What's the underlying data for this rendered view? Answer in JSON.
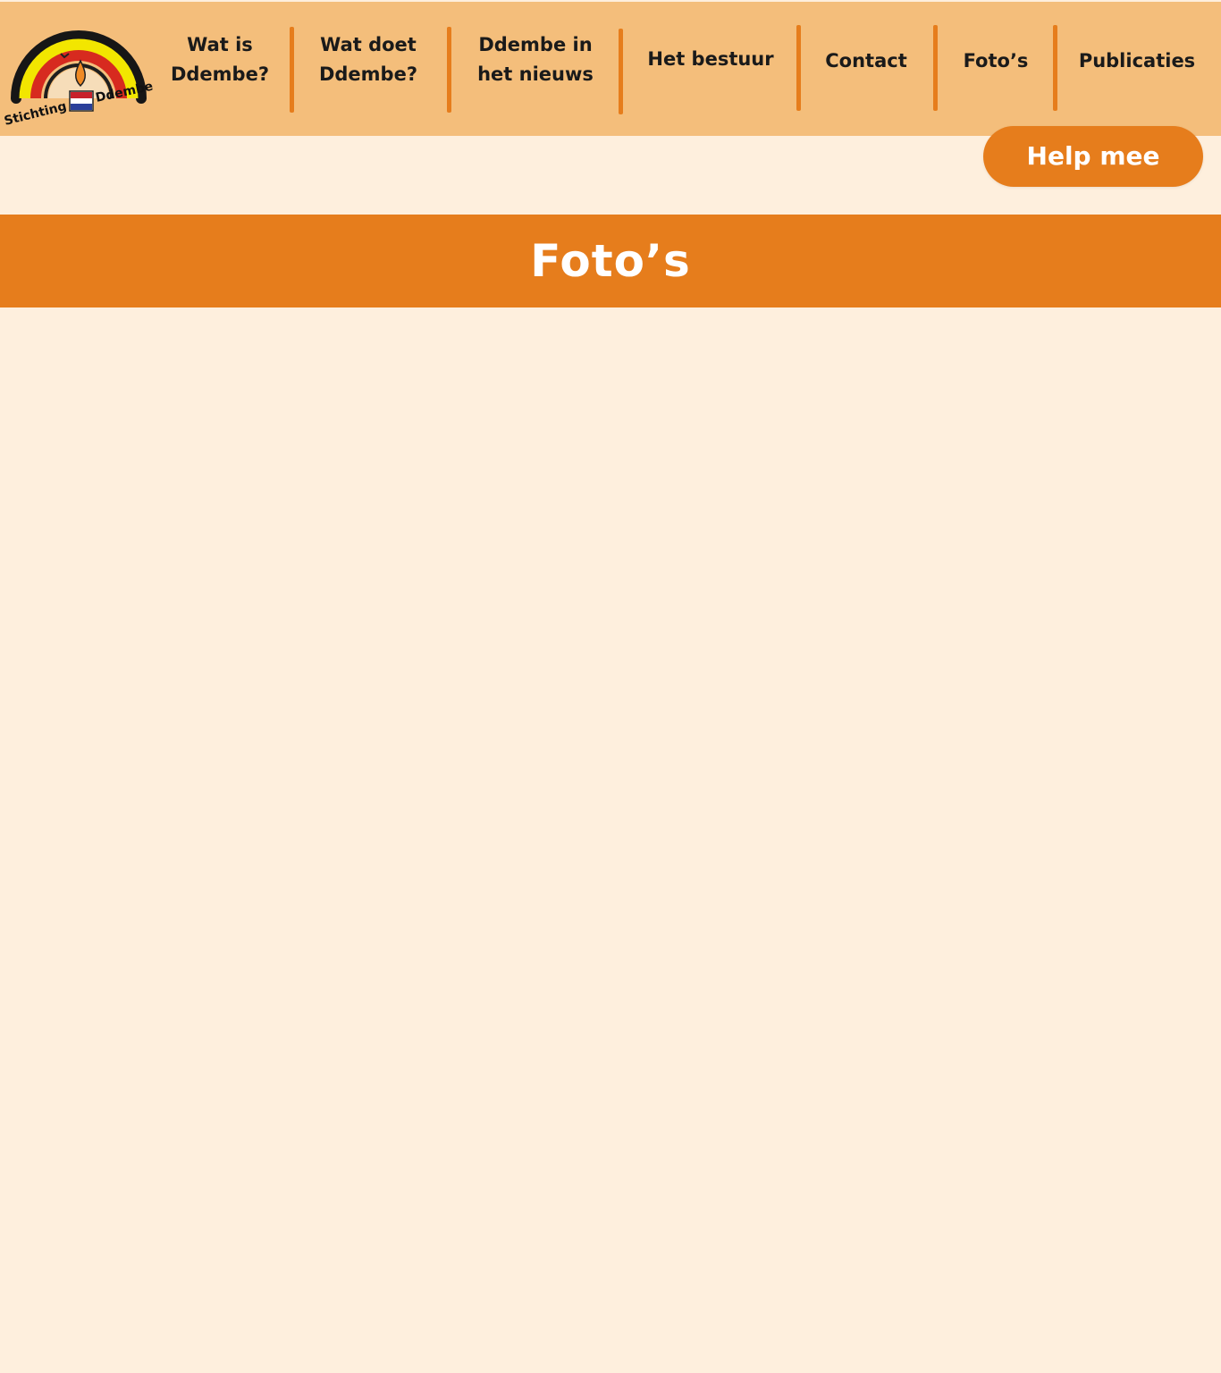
{
  "logo": {
    "alt": "Stichting Ddembe",
    "text_left": "Stichting",
    "text_right": "Ddembe"
  },
  "nav": [
    {
      "label": "Wat is\nDdembe?"
    },
    {
      "label": "Wat doet\nDdembe?"
    },
    {
      "label": "Ddembe in\nhet nieuws"
    },
    {
      "label": "Het bestuur"
    },
    {
      "label": "Contact"
    },
    {
      "label": "Foto’s"
    },
    {
      "label": "Publicaties"
    }
  ],
  "cta": {
    "label": "Help mee"
  },
  "page": {
    "title": "Foto’s"
  },
  "colors": {
    "header_bg": "#F4BE7B",
    "page_bg": "#FEEFDD",
    "accent": "#E67D1C",
    "nav_text": "#1A1A1A"
  }
}
